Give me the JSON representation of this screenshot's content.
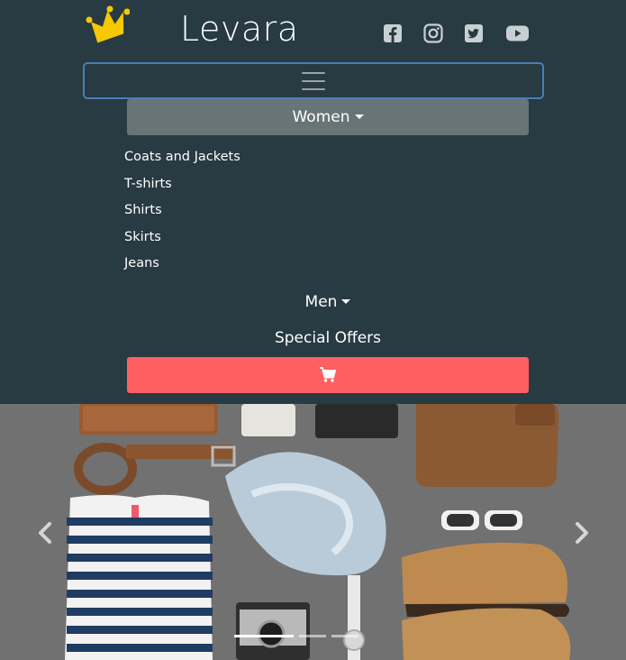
{
  "brand": {
    "name": "Levara",
    "logo_icon": "crown-icon",
    "logo_color": "#f6c800"
  },
  "social": [
    {
      "name": "facebook-icon"
    },
    {
      "name": "instagram-icon"
    },
    {
      "name": "twitter-icon"
    },
    {
      "name": "youtube-icon"
    }
  ],
  "nav": {
    "toggler_icon": "hamburger-icon",
    "women_label": "Women",
    "women_items": [
      "Coats and Jackets",
      "T-shirts",
      "Shirts",
      "Skirts",
      "Jeans"
    ],
    "men_label": "Men",
    "offers_label": "Special Offers",
    "cart_icon": "shopping-cart-icon"
  },
  "colors": {
    "nav_bg": "#283a42",
    "active_dropdown": "#687576",
    "cart_button": "#fe5f60",
    "toggler_border": "#4a7fb8"
  },
  "carousel": {
    "prev_icon": "chevron-left-icon",
    "next_icon": "chevron-right-icon",
    "indicator_count": 3,
    "active_index": 0
  }
}
